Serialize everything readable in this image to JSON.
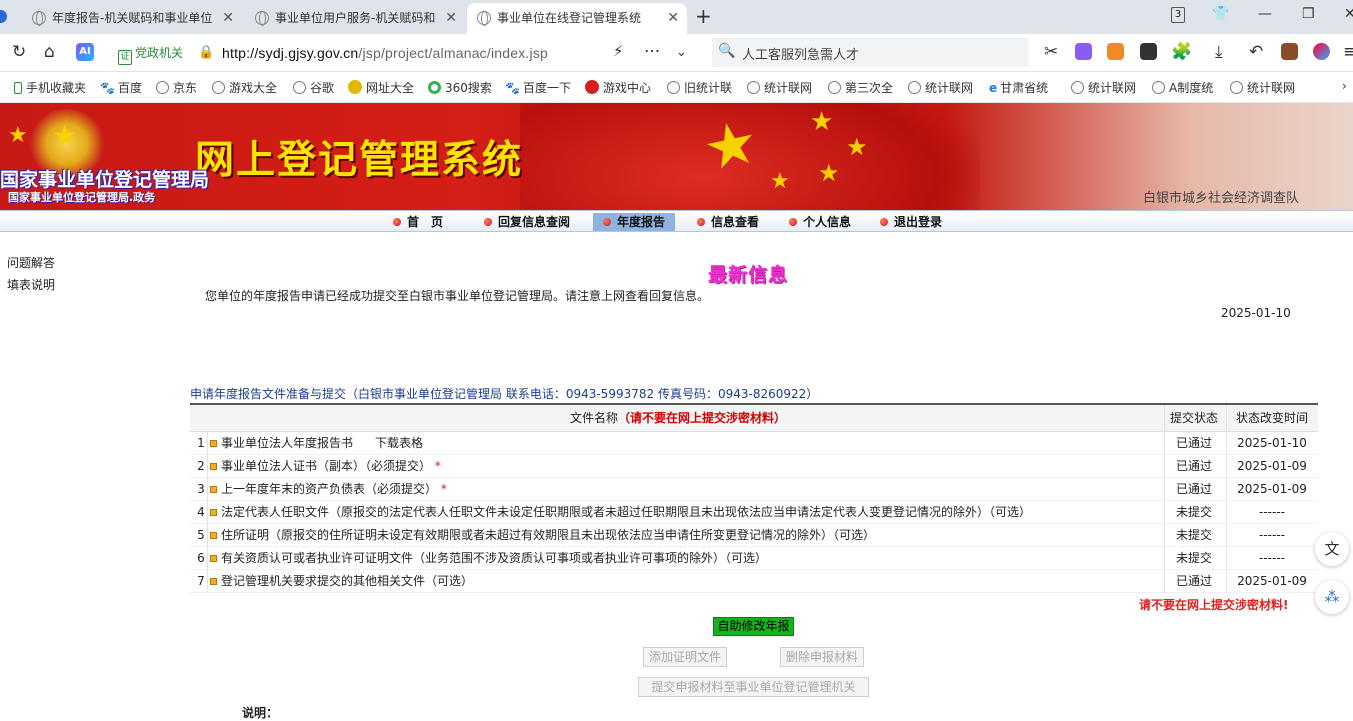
{
  "browser": {
    "tabs": [
      {
        "label": "年度报告-机关赋码和事业单位"
      },
      {
        "label": "事业单位用户服务-机关赋码和"
      },
      {
        "label": "事业单位在线登记管理系统"
      }
    ],
    "tab_count": "3",
    "address": {
      "cert_label": "党政机关",
      "url_scheme_host": "http://sydj.gjsy.gov.cn",
      "url_path": "/jsp/project/almanac/index.jsp"
    },
    "search_placeholder": "人工客服列急需人才",
    "bookmarks": [
      "手机收藏夹",
      "百度",
      "京东",
      "游戏大全",
      "谷歌",
      "网址大全",
      "360搜索",
      "百度一下",
      "游戏中心",
      "旧统计联",
      "统计联网",
      "第三次全",
      "统计联网",
      "甘肃省统",
      "统计联网",
      "A制度统",
      "统计联网"
    ]
  },
  "site": {
    "title": "网上登记管理系统",
    "org_name": "国家事业单位登记管理局",
    "org_sub": "国家事业单位登记管理局.政务",
    "unit_name": "白银市城乡社会经济调查队",
    "menu": [
      "首　页",
      "回复信息查阅",
      "年度报告",
      "信息查看",
      "个人信息",
      "退出登录"
    ],
    "active_menu": "年度报告"
  },
  "sidebar": [
    "问题解答",
    "填表说明"
  ],
  "news": {
    "title": "最新信息",
    "text": "您单位的年度报告申请已经成功提交至白银市事业单位登记管理局。请注意上网查看回复信息。",
    "date": "2025-01-10"
  },
  "files": {
    "heading": "申请年度报告文件准备与提交（白银市事业单位登记管理局 联系电话：0943-5993782 传真号码：0943-8260922）",
    "columns": {
      "name": "文件名称",
      "name_warning": "（请不要在网上提交涉密材料）",
      "status": "提交状态",
      "time": "状态改变时间"
    },
    "rows": [
      {
        "no": "1",
        "name": "事业单位法人年度报告书",
        "extra": "下载表格",
        "required": false,
        "status": "已通过",
        "time": "2025-01-10"
      },
      {
        "no": "2",
        "name": "事业单位法人证书（副本）（必须提交）",
        "extra": "",
        "required": true,
        "status": "已通过",
        "time": "2025-01-09"
      },
      {
        "no": "3",
        "name": "上一年度年末的资产负债表（必须提交）",
        "extra": "",
        "required": true,
        "status": "已通过",
        "time": "2025-01-09"
      },
      {
        "no": "4",
        "name": "法定代表人任职文件（原报交的法定代表人任职文件未设定任职期限或者未超过任职期限且未出现依法应当申请法定代表人变更登记情况的除外）（可选）",
        "extra": "",
        "required": false,
        "status": "未提交",
        "time": "------"
      },
      {
        "no": "5",
        "name": "住所证明（原报交的住所证明未设定有效期限或者未超过有效期限且未出现依法应当申请住所变更登记情况的除外）（可选）",
        "extra": "",
        "required": false,
        "status": "未提交",
        "time": "------"
      },
      {
        "no": "6",
        "name": "有关资质认可或者执业许可证明文件（业务范围不涉及资质认可事项或者执业许可事项的除外）（可选）",
        "extra": "",
        "required": false,
        "status": "未提交",
        "time": "------"
      },
      {
        "no": "7",
        "name": "登记管理机关要求提交的其他相关文件（可选）",
        "extra": "",
        "required": false,
        "status": "已通过",
        "time": "2025-01-09"
      }
    ],
    "required_mark": "*",
    "warning": "请不要在网上提交涉密材料!"
  },
  "actions": {
    "self_modify": "自助修改年报",
    "add_proof": "添加证明文件",
    "delete_material": "删除申报材料",
    "submit": "提交申报材料至事业单位登记管理机关"
  },
  "note_label": "说明："
}
